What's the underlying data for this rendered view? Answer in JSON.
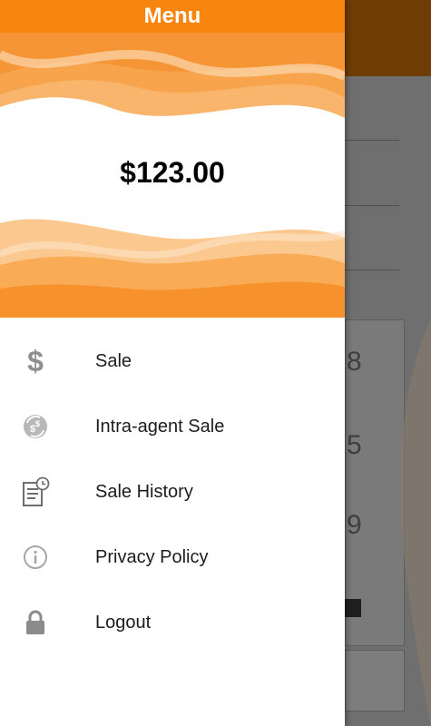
{
  "drawer": {
    "title": "Menu",
    "balance": "$123.00",
    "items": [
      {
        "label": "Sale",
        "icon": "dollar-icon"
      },
      {
        "label": "Intra-agent Sale",
        "icon": "currency-exchange-icon"
      },
      {
        "label": "Sale History",
        "icon": "history-document-icon"
      },
      {
        "label": "Privacy Policy",
        "icon": "info-icon"
      },
      {
        "label": "Logout",
        "icon": "lock-icon"
      }
    ]
  },
  "background": {
    "digits": [
      "8",
      "5",
      "9"
    ]
  },
  "colors": {
    "accent": "#f7860f",
    "topbar": "#6e3d05",
    "icon": "#8b8b8b"
  }
}
